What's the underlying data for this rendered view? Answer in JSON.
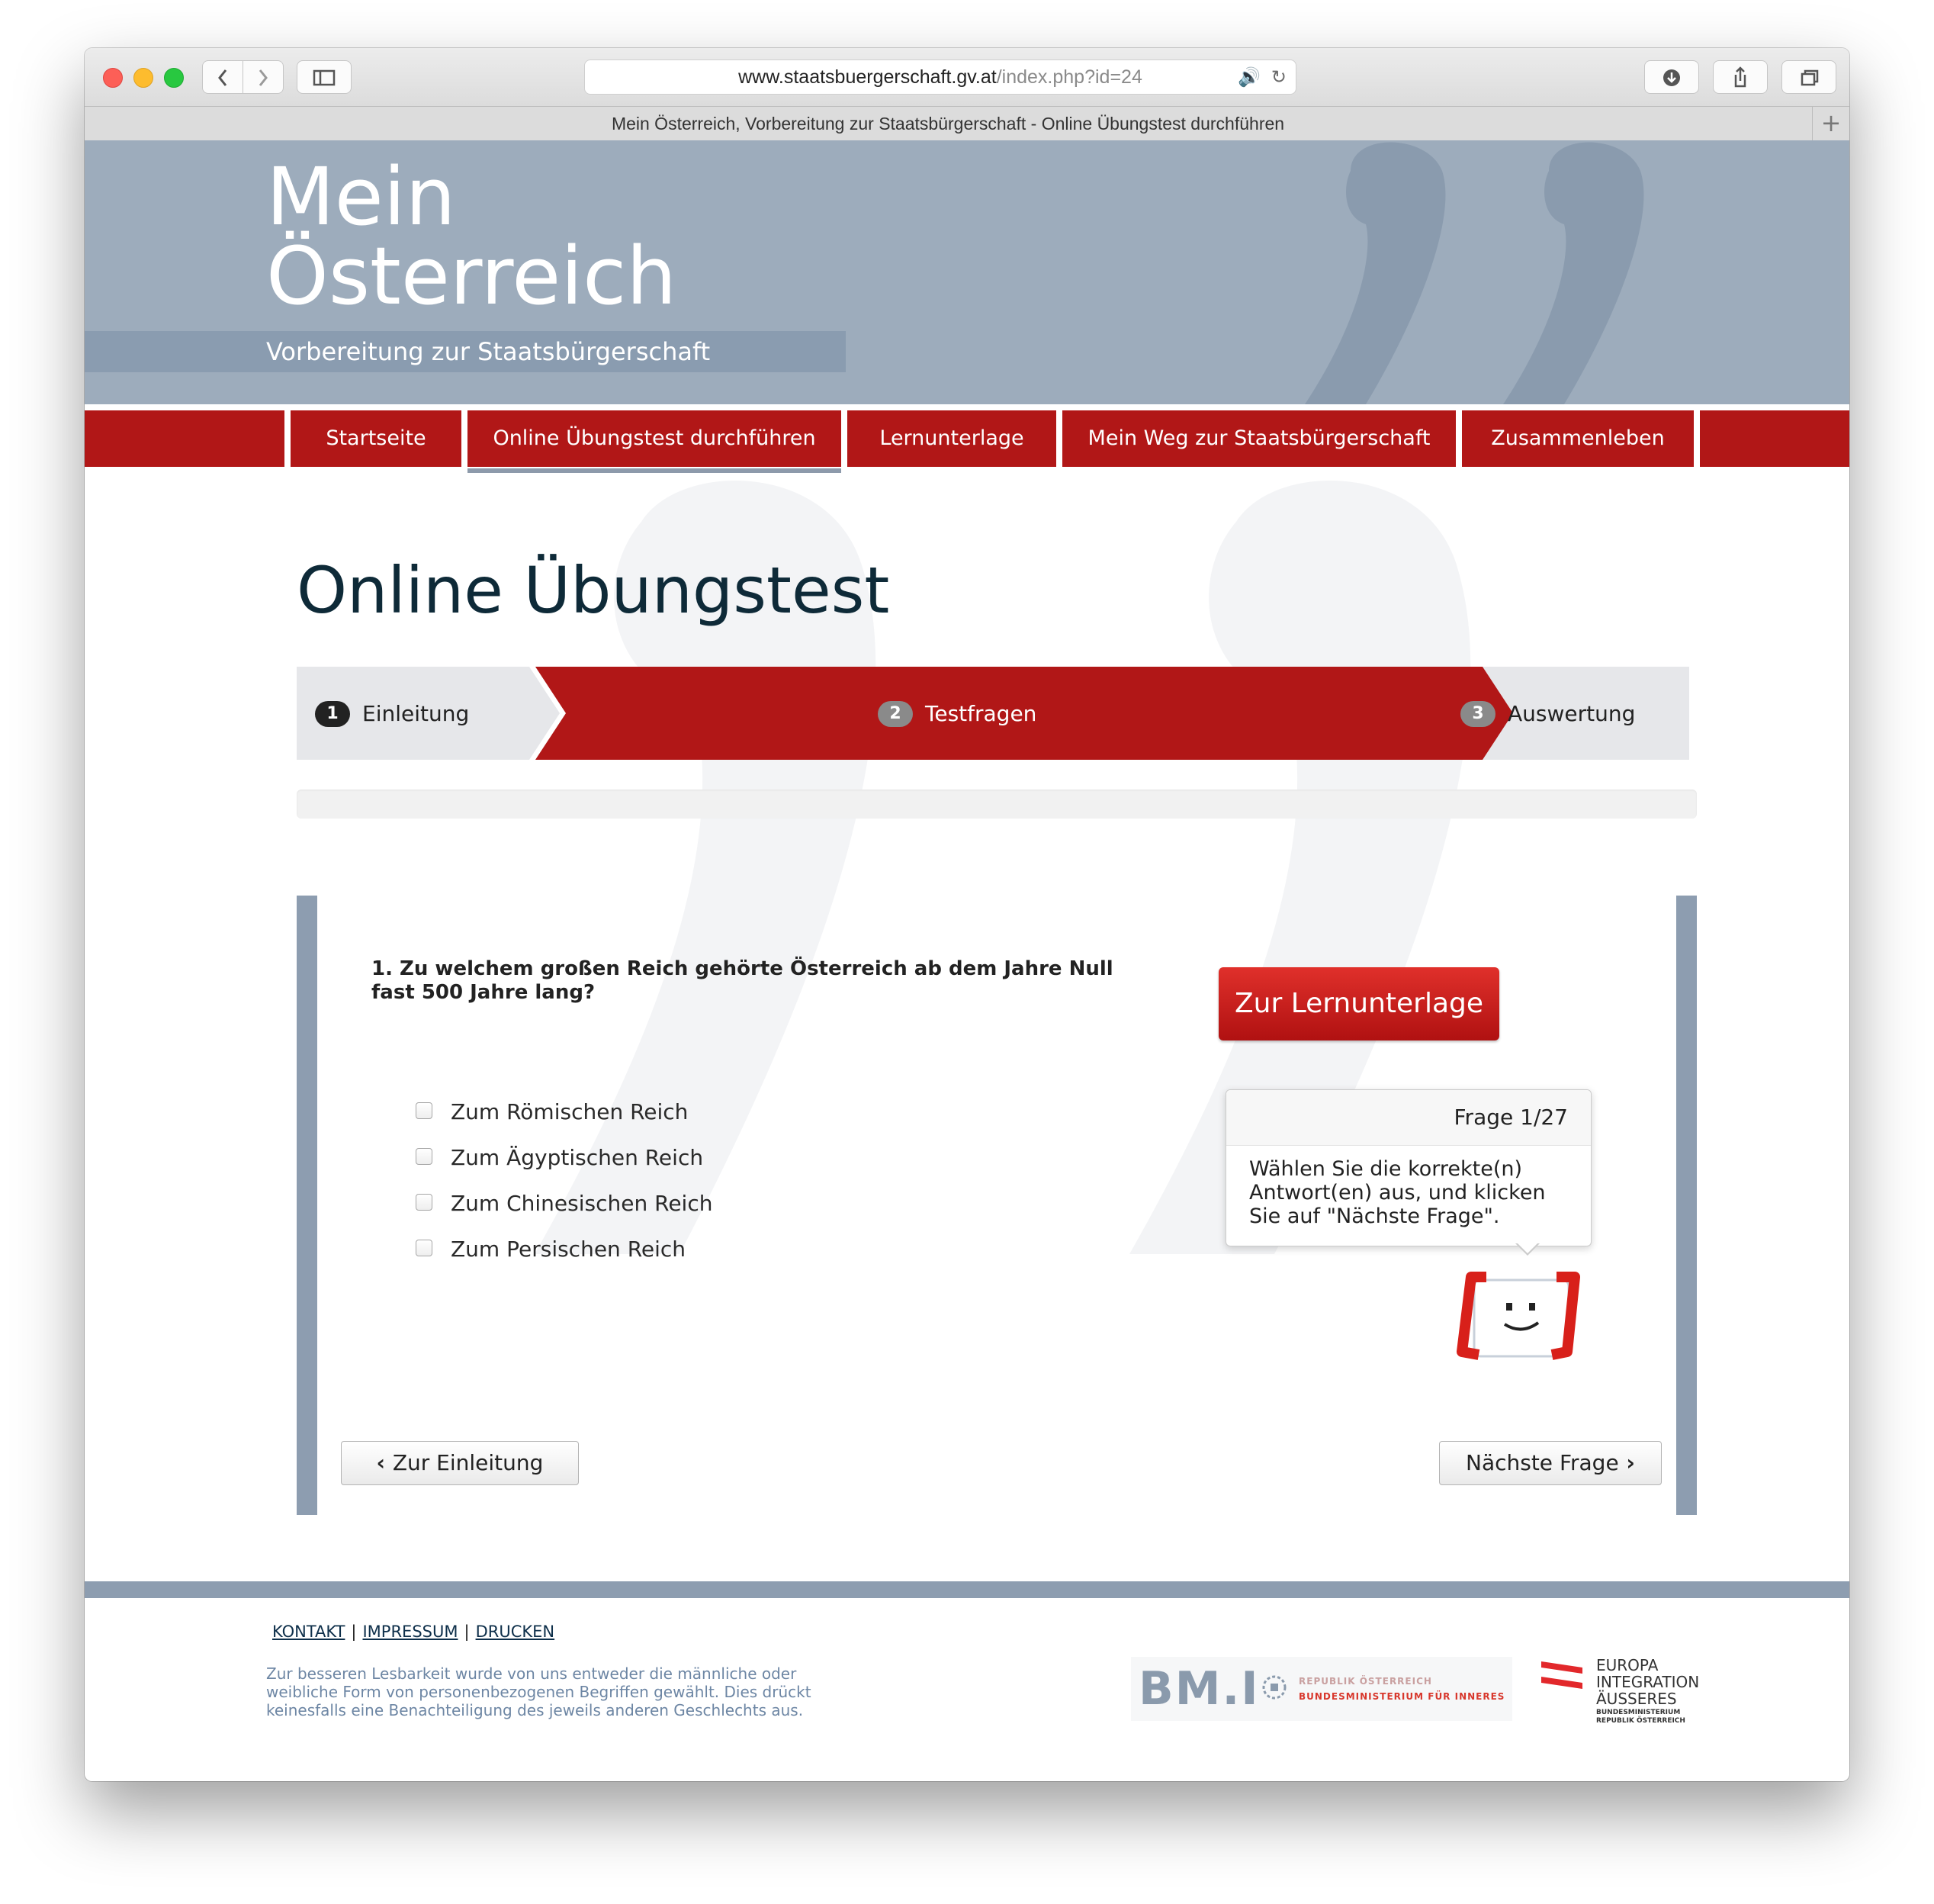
{
  "browser": {
    "url_host": "www.staatsbuergerschaft.gv.at",
    "url_path": "/index.php?id=24",
    "tab_title": "Mein Österreich, Vorbereitung zur Staatsbürgerschaft - Online Übungstest durchführen",
    "icons": [
      "back-icon",
      "forward-icon",
      "sidebar-icon",
      "audio-icon",
      "reload-icon",
      "download-icon",
      "share-icon",
      "tabs-icon",
      "new-tab-icon"
    ]
  },
  "site": {
    "title_line1": "Mein",
    "title_line2": "Österreich",
    "subtitle": "Vorbereitung zur Staatsbürgerschaft"
  },
  "nav": {
    "items": [
      {
        "label": "Startseite"
      },
      {
        "label": "Online Übungstest durchführen",
        "active": true
      },
      {
        "label": "Lernunterlage"
      },
      {
        "label": "Mein Weg zur Staatsbürgerschaft"
      },
      {
        "label": "Zusammenleben"
      }
    ]
  },
  "main": {
    "heading": "Online Übungstest",
    "steps": [
      {
        "num": "1",
        "label": "Einleitung"
      },
      {
        "num": "2",
        "label": "Testfragen",
        "active": true
      },
      {
        "num": "3",
        "label": "Auswertung"
      }
    ],
    "question": "1. Zu welchem großen Reich gehörte Österreich ab dem Jahre Null fast 500 Jahre lang?",
    "answers": [
      {
        "label": "Zum Römischen Reich",
        "checked": false
      },
      {
        "label": "Zum Ägyptischen Reich",
        "checked": false
      },
      {
        "label": "Zum Chinesischen Reich",
        "checked": false
      },
      {
        "label": "Zum Persischen Reich",
        "checked": false
      }
    ],
    "lern_button": "Zur Lernunterlage",
    "tooltip": {
      "counter": "Frage 1/27",
      "text": "Wählen Sie die korrekte(n) Antwort(en) aus, und klicken Sie auf \"Nächste Frage\"."
    },
    "prev_button": "Zur Einleitung",
    "next_button": "Nächste Frage"
  },
  "footer": {
    "links": [
      "KONTAKT",
      "IMPRESSUM",
      "DRUCKEN"
    ],
    "note": "Zur besseren Lesbarkeit wurde von uns entweder die männliche oder weibliche Form von personenbezogenen Begriffen gewählt. Dies drückt keinesfalls eine Benachteiligung des jeweils anderen Geschlechts aus.",
    "bmi_logo": {
      "mark": "BM.I",
      "line1": "REPUBLIK ÖSTERREICH",
      "line2": "BUNDESMINISTERIUM FÜR INNERES"
    },
    "eu_logo": {
      "line1": "EUROPA",
      "line2": "INTEGRATION",
      "line3": "ÄUSSERES",
      "line4": "BUNDESMINISTERIUM",
      "line5": "REPUBLIK ÖSTERREICH"
    }
  },
  "colors": {
    "brand_red": "#b11717",
    "header_blue": "#9dacbc",
    "step_gray": "#e6e7ea"
  }
}
